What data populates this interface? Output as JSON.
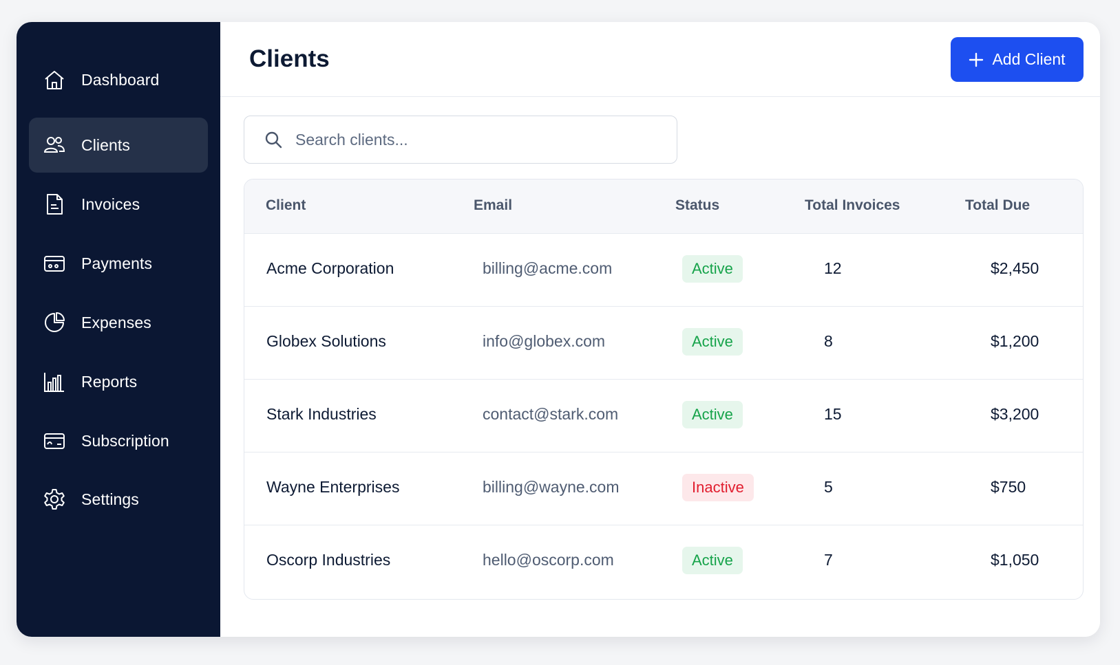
{
  "sidebar": {
    "items": [
      {
        "label": "Dashboard",
        "icon": "home-icon",
        "active": false
      },
      {
        "label": "Clients",
        "icon": "users-icon",
        "active": true
      },
      {
        "label": "Invoices",
        "icon": "document-icon",
        "active": false
      },
      {
        "label": "Payments",
        "icon": "wallet-icon",
        "active": false
      },
      {
        "label": "Expenses",
        "icon": "pie-chart-icon",
        "active": false
      },
      {
        "label": "Reports",
        "icon": "bar-chart-icon",
        "active": false
      },
      {
        "label": "Subscription",
        "icon": "credit-card-icon",
        "active": false
      },
      {
        "label": "Settings",
        "icon": "gear-icon",
        "active": false
      }
    ]
  },
  "header": {
    "title": "Clients",
    "add_button_label": "Add Client"
  },
  "search": {
    "placeholder": "Search clients..."
  },
  "table": {
    "columns": [
      "Client",
      "Email",
      "Status",
      "Total Invoices",
      "Total Due"
    ],
    "rows": [
      {
        "client": "Acme Corporation",
        "email": "billing@acme.com",
        "status": "Active",
        "total_invoices": "12",
        "total_due": "$2,450"
      },
      {
        "client": "Globex Solutions",
        "email": "info@globex.com",
        "status": "Active",
        "total_invoices": "8",
        "total_due": "$1,200"
      },
      {
        "client": "Stark Industries",
        "email": "contact@stark.com",
        "status": "Active",
        "total_invoices": "15",
        "total_due": "$3,200"
      },
      {
        "client": "Wayne Enterprises",
        "email": "billing@wayne.com",
        "status": "Inactive",
        "total_invoices": "5",
        "total_due": "$750"
      },
      {
        "client": "Oscorp Industries",
        "email": "hello@oscorp.com",
        "status": "Active",
        "total_invoices": "7",
        "total_due": "$1,050"
      }
    ]
  },
  "colors": {
    "sidebar_bg": "#0b1733",
    "sidebar_active_bg": "#253149",
    "accent": "#1d4ff0",
    "active_text": "#16a34a",
    "active_bg": "#e6f6ec",
    "inactive_text": "#e11d2e",
    "inactive_bg": "#fde8ea"
  }
}
